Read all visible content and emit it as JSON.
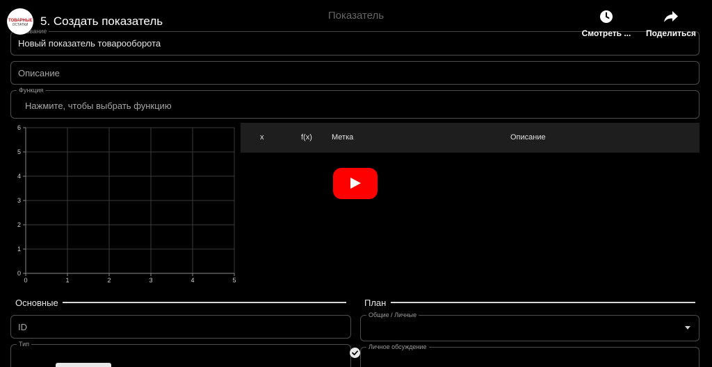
{
  "app": {
    "title": "Показатель"
  },
  "form": {
    "name_legend": "Название",
    "name_value": "Новый показатель товарооборота",
    "description_placeholder": "Описание",
    "function_legend": "Функция",
    "function_placeholder": "Нажмите, чтобы выбрать функцию"
  },
  "chart_data": {
    "type": "line",
    "x_ticks": [
      "0",
      "1",
      "2",
      "3",
      "4",
      "5"
    ],
    "y_ticks": [
      "0",
      "1",
      "2",
      "3",
      "4",
      "5",
      "6"
    ],
    "xlim": [
      0,
      5
    ],
    "ylim": [
      0,
      6
    ],
    "grid": true,
    "series": []
  },
  "table": {
    "columns": [
      "x",
      "f(x)",
      "Метка",
      "Описание"
    ]
  },
  "sections": {
    "basic": "Основные",
    "plan": "План"
  },
  "basic": {
    "id_placeholder": "ID",
    "type_legend": "Тип"
  },
  "plan": {
    "scope_legend": "Общие / Личные",
    "next_legend": "Личное обсуждение"
  },
  "youtube": {
    "channel_logo_text": "ТОВАРНЫЕ",
    "channel_logo_sub": "ОСТАТКИ",
    "video_title": "5. Создать показатель",
    "watch_later_label": "Смотреть ...",
    "share_label": "Поделиться",
    "play_color": "#ff0000"
  }
}
